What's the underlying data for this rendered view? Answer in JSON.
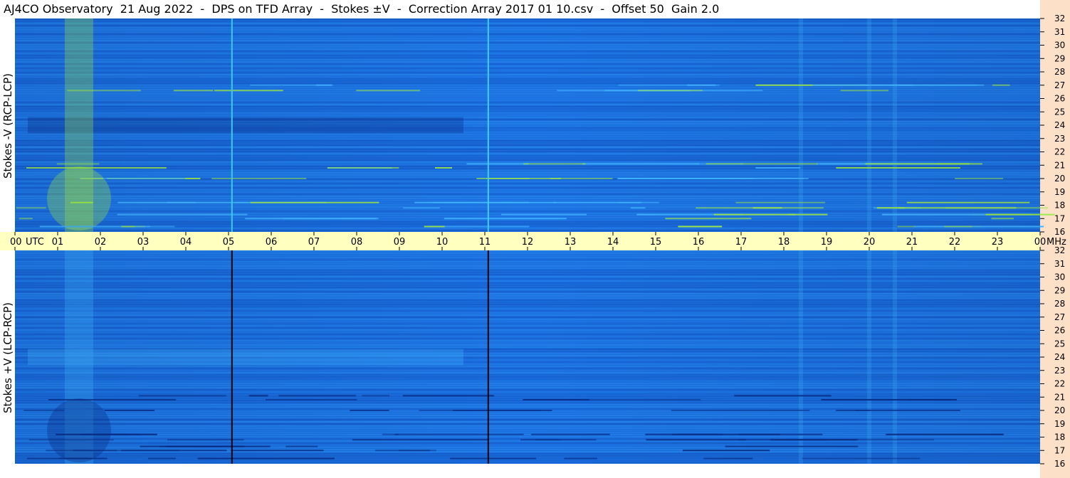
{
  "title": "AJ4CO Observatory  21 Aug 2022  -  DPS on TFD Array  -  Stokes ±V  -  Correction Array 2017 01 10.csv  -  Offset 50  Gain 2.0",
  "colors": {
    "background": "#ffffff",
    "time_axis_band": "#ffffc0",
    "freq_axis_band": "#fde0c8",
    "plot_base": "#1a6ee0",
    "plot_dark": "#0a2f8a",
    "plot_light": "#3fb2ff",
    "plot_bright": "#9de84a"
  },
  "chart_data": [
    {
      "type": "heatmap",
      "panel": "top",
      "ylabel": "Stokes -V (RCP-LCP)",
      "y_ticks": [
        "16",
        "17",
        "18",
        "19",
        "20",
        "21",
        "22",
        "23",
        "24",
        "25",
        "26",
        "27",
        "28",
        "29",
        "30",
        "31",
        "32"
      ],
      "ylim": [
        16,
        32
      ],
      "y_unit": "",
      "xlim": [
        0,
        24
      ],
      "vertical_lines": [
        {
          "utc": 5.08,
          "color": "#3fd0ff"
        },
        {
          "utc": 11.08,
          "color": "#3fd0ff"
        }
      ],
      "bright_rows_mhz": [
        16.4,
        17.0,
        17.3,
        17.8,
        18.2,
        20.0,
        20.8,
        21.1,
        26.6,
        27.0
      ],
      "bright_columns_utc": [
        1.5,
        18.4,
        20.0,
        20.6
      ]
    },
    {
      "type": "heatmap",
      "panel": "bottom",
      "ylabel": "Stokes +V (LCP-RCP)",
      "y_ticks": [
        "16",
        "17",
        "18",
        "19",
        "20",
        "21",
        "22",
        "23",
        "24",
        "25",
        "26",
        "27",
        "28",
        "29",
        "30",
        "31",
        "32"
      ],
      "ylim": [
        16,
        32
      ],
      "y_unit": "MHz",
      "xlim": [
        0,
        24
      ],
      "vertical_lines": [
        {
          "utc": 5.08,
          "color": "#000000"
        },
        {
          "utc": 11.08,
          "color": "#000000"
        }
      ],
      "dark_rows_mhz": [
        16.4,
        17.0,
        17.3,
        17.8,
        18.2,
        20.0,
        20.8,
        21.1
      ],
      "bright_columns_utc": [
        1.5,
        18.4,
        20.0,
        20.6
      ]
    }
  ],
  "time_axis": {
    "labels": [
      "00",
      "01",
      "02",
      "03",
      "04",
      "05",
      "06",
      "07",
      "08",
      "09",
      "10",
      "11",
      "12",
      "13",
      "14",
      "15",
      "16",
      "17",
      "18",
      "19",
      "20",
      "21",
      "22",
      "23",
      "00"
    ],
    "utc_label": "UTC",
    "unit": "MHz"
  }
}
